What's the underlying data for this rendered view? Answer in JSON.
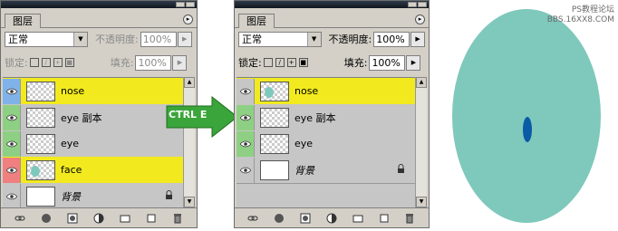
{
  "panel_title": "图层",
  "blend_mode": "正常",
  "opacity_label": "不透明度:",
  "opacity_left": "100%",
  "opacity_right": "100%",
  "lock_label": "锁定:",
  "fill_label": "填充:",
  "fill_left": "100%",
  "fill_right": "100%",
  "colors": {
    "selected_row": "#f2ea1f",
    "eye_blue": "#7fb2e8",
    "eye_green": "#8ed083",
    "eye_red": "#f07f7f",
    "eye_gray": "#c6c6c6",
    "ellipse_fill": "#7fc8bc",
    "pupil_fill": "#0b5aa6",
    "arrow_green": "#3aa53a"
  },
  "left_layers": [
    {
      "name": "nose",
      "eye": "blue",
      "thumb": "checker",
      "selected": true
    },
    {
      "name": "eye 副本",
      "eye": "green",
      "thumb": "checker",
      "selected": false
    },
    {
      "name": "eye",
      "eye": "green",
      "thumb": "checker",
      "selected": false
    },
    {
      "name": "face",
      "eye": "red",
      "thumb": "blob",
      "selected": true
    },
    {
      "name": "背景",
      "eye": "gray",
      "thumb": "white",
      "selected": false,
      "locked": true
    }
  ],
  "right_layers": [
    {
      "name": "nose",
      "eye": "gray",
      "thumb": "blob-checker",
      "selected": true
    },
    {
      "name": "eye 副本",
      "eye": "green",
      "thumb": "checker",
      "selected": false
    },
    {
      "name": "eye",
      "eye": "green",
      "thumb": "checker",
      "selected": false
    },
    {
      "name": "背景",
      "eye": "gray",
      "thumb": "white",
      "selected": false,
      "locked": true
    }
  ],
  "shortcut_label": "CTRL E",
  "watermark_line1": "PS教程论坛",
  "watermark_line2": "BBS.16XX8.COM"
}
